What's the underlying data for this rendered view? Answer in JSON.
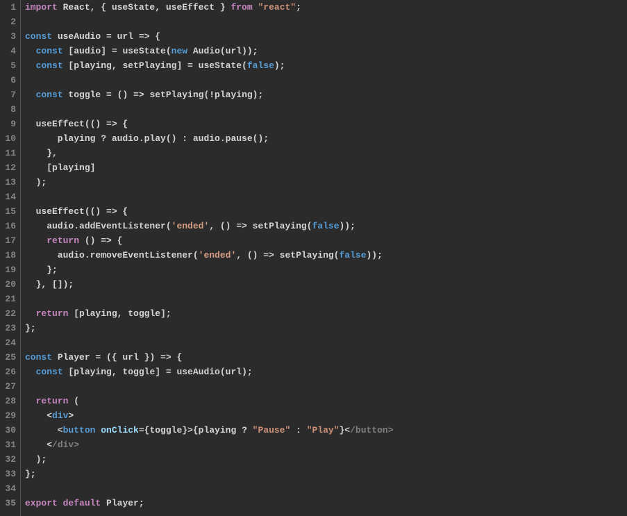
{
  "editor": {
    "lineCount": 35,
    "lines": [
      [
        {
          "t": "import",
          "c": "tok-keyword2"
        },
        {
          "t": " React, { useState, useEffect } ",
          "c": "tok-plain"
        },
        {
          "t": "from",
          "c": "tok-keyword2"
        },
        {
          "t": " ",
          "c": "tok-plain"
        },
        {
          "t": "\"react\"",
          "c": "tok-string"
        },
        {
          "t": ";",
          "c": "tok-punct"
        }
      ],
      [],
      [
        {
          "t": "const",
          "c": "tok-keyword"
        },
        {
          "t": " useAudio = url => {",
          "c": "tok-plain"
        }
      ],
      [
        {
          "t": "  ",
          "c": "tok-plain"
        },
        {
          "t": "const",
          "c": "tok-keyword"
        },
        {
          "t": " [audio] = useState(",
          "c": "tok-plain"
        },
        {
          "t": "new",
          "c": "tok-new"
        },
        {
          "t": " Audio(url));",
          "c": "tok-plain"
        }
      ],
      [
        {
          "t": "  ",
          "c": "tok-plain"
        },
        {
          "t": "const",
          "c": "tok-keyword"
        },
        {
          "t": " [playing, setPlaying] = useState(",
          "c": "tok-plain"
        },
        {
          "t": "false",
          "c": "tok-const"
        },
        {
          "t": ");",
          "c": "tok-plain"
        }
      ],
      [],
      [
        {
          "t": "  ",
          "c": "tok-plain"
        },
        {
          "t": "const",
          "c": "tok-keyword"
        },
        {
          "t": " toggle = () => setPlaying(!playing);",
          "c": "tok-plain"
        }
      ],
      [],
      [
        {
          "t": "  useEffect(() => {",
          "c": "tok-plain"
        }
      ],
      [
        {
          "t": "      playing ? audio.play() : audio.pause();",
          "c": "tok-plain"
        }
      ],
      [
        {
          "t": "    },",
          "c": "tok-plain"
        }
      ],
      [
        {
          "t": "    [playing]",
          "c": "tok-plain"
        }
      ],
      [
        {
          "t": "  );",
          "c": "tok-plain"
        }
      ],
      [],
      [
        {
          "t": "  useEffect(() => {",
          "c": "tok-plain"
        }
      ],
      [
        {
          "t": "    audio.addEventListener(",
          "c": "tok-plain"
        },
        {
          "t": "'ended'",
          "c": "tok-string2"
        },
        {
          "t": ", () => setPlaying(",
          "c": "tok-plain"
        },
        {
          "t": "false",
          "c": "tok-const"
        },
        {
          "t": "));",
          "c": "tok-plain"
        }
      ],
      [
        {
          "t": "    ",
          "c": "tok-plain"
        },
        {
          "t": "return",
          "c": "tok-return"
        },
        {
          "t": " () => {",
          "c": "tok-plain"
        }
      ],
      [
        {
          "t": "      audio.removeEventListener(",
          "c": "tok-plain"
        },
        {
          "t": "'ended'",
          "c": "tok-string2"
        },
        {
          "t": ", () => setPlaying(",
          "c": "tok-plain"
        },
        {
          "t": "false",
          "c": "tok-const"
        },
        {
          "t": "));",
          "c": "tok-plain"
        }
      ],
      [
        {
          "t": "    };",
          "c": "tok-plain"
        }
      ],
      [
        {
          "t": "  }, []);",
          "c": "tok-plain"
        }
      ],
      [],
      [
        {
          "t": "  ",
          "c": "tok-plain"
        },
        {
          "t": "return",
          "c": "tok-return"
        },
        {
          "t": " [playing, toggle];",
          "c": "tok-plain"
        }
      ],
      [
        {
          "t": "};",
          "c": "tok-plain"
        }
      ],
      [],
      [
        {
          "t": "const",
          "c": "tok-keyword"
        },
        {
          "t": " Player = ({ url }) => {",
          "c": "tok-plain"
        }
      ],
      [
        {
          "t": "  ",
          "c": "tok-plain"
        },
        {
          "t": "const",
          "c": "tok-keyword"
        },
        {
          "t": " [playing, toggle] = useAudio(url);",
          "c": "tok-plain"
        }
      ],
      [],
      [
        {
          "t": "  ",
          "c": "tok-plain"
        },
        {
          "t": "return",
          "c": "tok-return"
        },
        {
          "t": " (",
          "c": "tok-plain"
        }
      ],
      [
        {
          "t": "    <",
          "c": "tok-plain"
        },
        {
          "t": "div",
          "c": "tok-jsx-tag"
        },
        {
          "t": ">",
          "c": "tok-plain"
        }
      ],
      [
        {
          "t": "      <",
          "c": "tok-plain"
        },
        {
          "t": "button",
          "c": "tok-jsx-tag"
        },
        {
          "t": " ",
          "c": "tok-plain"
        },
        {
          "t": "onClick",
          "c": "tok-attr"
        },
        {
          "t": "={toggle}>{playing ? ",
          "c": "tok-plain"
        },
        {
          "t": "\"Pause\"",
          "c": "tok-string"
        },
        {
          "t": " : ",
          "c": "tok-plain"
        },
        {
          "t": "\"Play\"",
          "c": "tok-string"
        },
        {
          "t": "}<",
          "c": "tok-plain"
        },
        {
          "t": "/button>",
          "c": "tok-jsx-close"
        }
      ],
      [
        {
          "t": "    <",
          "c": "tok-plain"
        },
        {
          "t": "/div>",
          "c": "tok-jsx-close"
        }
      ],
      [
        {
          "t": "  );",
          "c": "tok-plain"
        }
      ],
      [
        {
          "t": "};",
          "c": "tok-plain"
        }
      ],
      [],
      [
        {
          "t": "export",
          "c": "tok-keyword2"
        },
        {
          "t": " ",
          "c": "tok-plain"
        },
        {
          "t": "default",
          "c": "tok-keyword2"
        },
        {
          "t": " Player;",
          "c": "tok-plain"
        }
      ]
    ]
  }
}
